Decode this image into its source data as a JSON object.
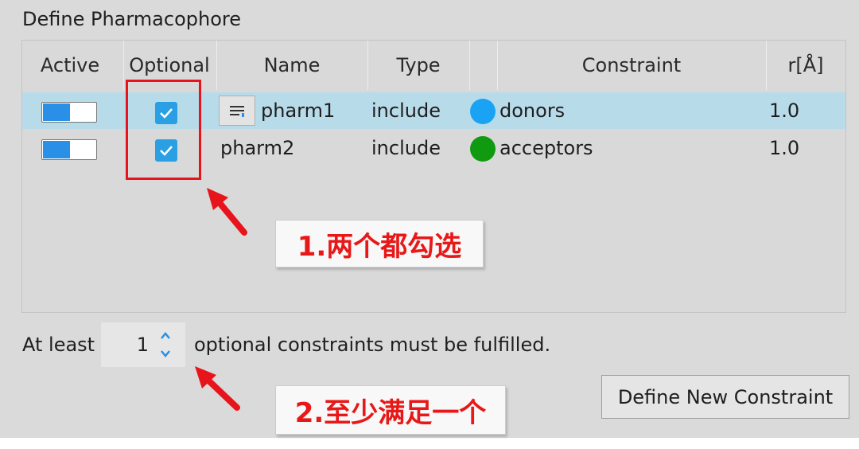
{
  "panel": {
    "title": "Define Pharmacophore"
  },
  "table": {
    "headers": {
      "active": "Active",
      "optional": "Optional",
      "name": "Name",
      "type": "Type",
      "constraint": "Constraint",
      "radius": "r[Å]"
    },
    "rows": [
      {
        "active": true,
        "optional": true,
        "name": "pharm1",
        "type": "include",
        "constraint": "donors",
        "constraint_color": "#1aa3f5",
        "radius": "1.0",
        "selected": true
      },
      {
        "active": true,
        "optional": true,
        "name": "pharm2",
        "type": "include",
        "constraint": "acceptors",
        "constraint_color": "#109a10",
        "radius": "1.0",
        "selected": false
      }
    ]
  },
  "footer": {
    "prefix": "At least",
    "count": "1",
    "suffix": "optional constraints must be fulfilled.",
    "button": "Define New Constraint"
  },
  "annotations": {
    "note1": "1.两个都勾选",
    "note2": "2.至少满足一个"
  },
  "colors": {
    "accent": "#2a9fe3",
    "annotation": "#e8141c",
    "selection": "#b8dbea"
  }
}
